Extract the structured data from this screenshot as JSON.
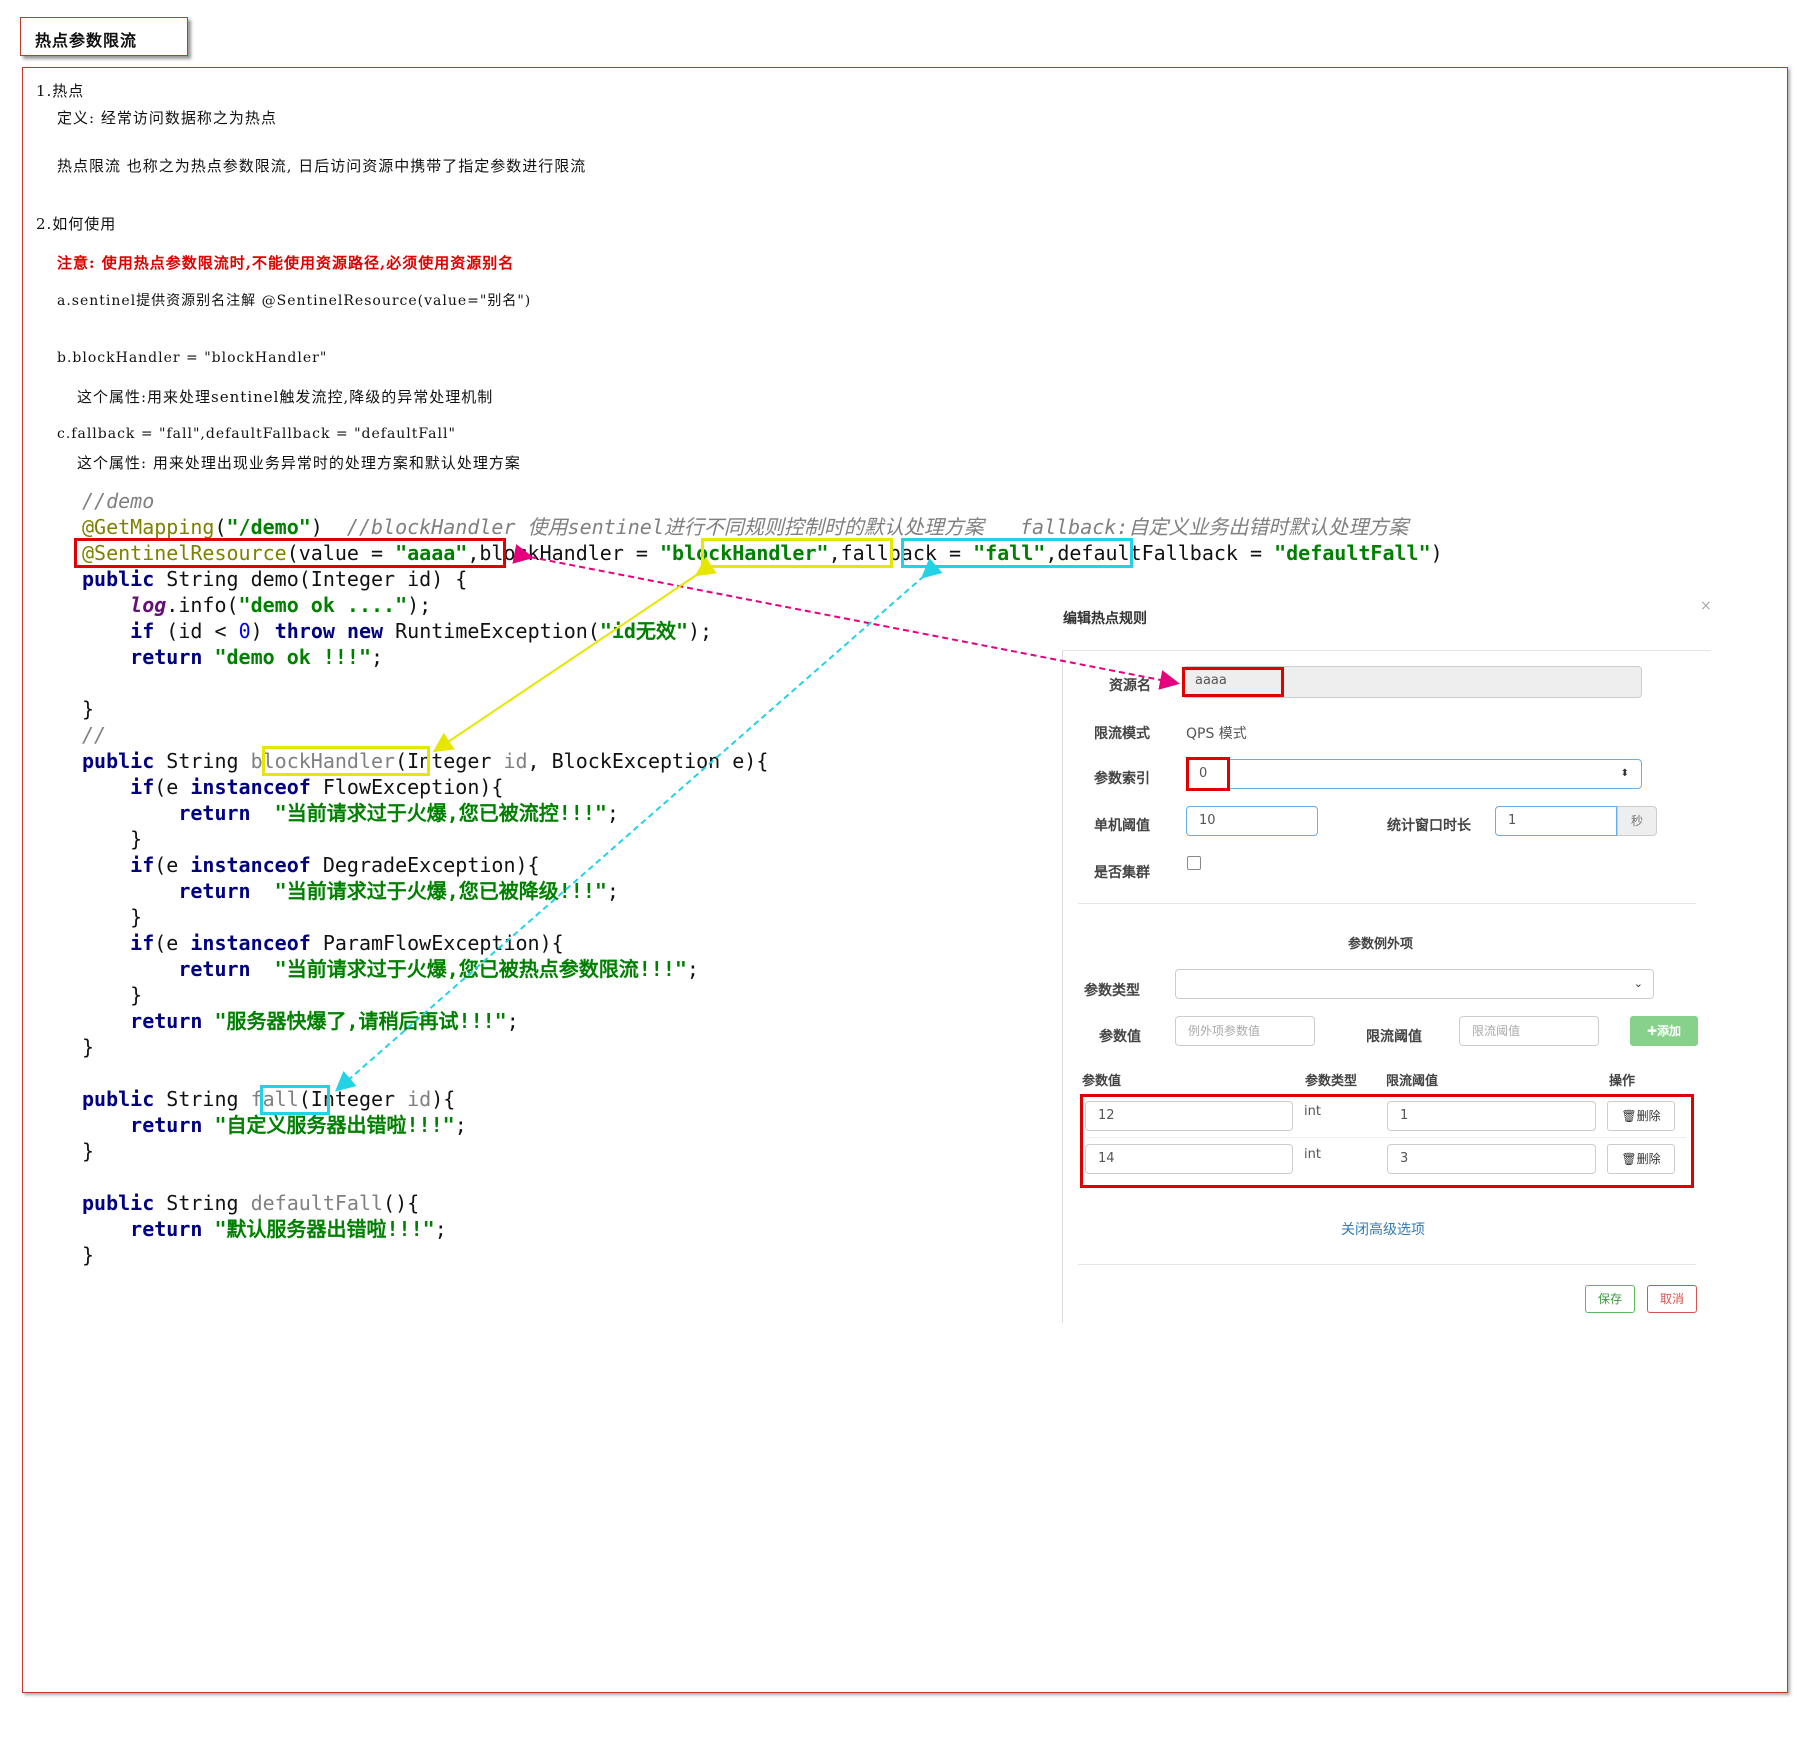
{
  "title": "热点参数限流",
  "notes": {
    "s1_heading": "1.热点",
    "s1_def": "定义: 经常访问数据称之为热点",
    "s1_desc": "热点限流 也称之为热点参数限流, 日后访问资源中携带了指定参数进行限流",
    "s2_heading": "2.如何使用",
    "warning": "注意: 使用热点参数限流时,不能使用资源路径,必须使用资源别名",
    "a": "a.sentinel提供资源别名注解  @SentinelResource(value=\"别名\")",
    "b": "b.blockHandler = \"blockHandler\"",
    "b_desc": "这个属性:用来处理sentinel触发流控,降级的异常处理机制",
    "c": "c.fallback = \"fall\",defaultFallback = \"defaultFall\"",
    "c_desc": "这个属性: 用来处理出现业务异常时的处理方案和默认处理方案"
  },
  "code": {
    "l01": "//demo",
    "l02_ann": "@GetMapping",
    "l02_path": "\"/demo\"",
    "l02_cmt": "//blockHandler 使用sentinel进行不同规则控制时的默认处理方案   fallback:自定义业务出错时默认处理方案",
    "l03_ann": "@SentinelResource",
    "l03_value": "\"aaaa\"",
    "l03_bh": "\"blockHandler\"",
    "l03_fb": "\"fall\"",
    "l03_dfb": "\"defaultFall\"",
    "l05_str": "\"demo ok ....\"",
    "l06_str": "\"id无效\"",
    "l07_str": "\"demo ok !!!\"",
    "l09": "//",
    "l10_name": "blockHandler",
    "l12_str": "\"当前请求过于火爆,您已被流控!!!\"",
    "l15_str": "\"当前请求过于火爆,您已被降级!!!\"",
    "l18_str": "\"当前请求过于火爆,您已被热点参数限流!!!\"",
    "l20_str": "\"服务器快爆了,请稍后再试!!!\"",
    "l22_name": "fall",
    "l23_str": "\"自定义服务器出错啦!!!\"",
    "l25_name": "defaultFall",
    "l26_str": "\"默认服务器出错啦!!!\""
  },
  "dialog": {
    "title": "编辑热点规则",
    "close": "×",
    "resource_label": "资源名",
    "resource_value": "aaaa",
    "mode_label": "限流模式",
    "mode_value": "QPS 模式",
    "index_label": "参数索引",
    "index_value": "0",
    "threshold_label": "单机阈值",
    "threshold_value": "10",
    "window_label": "统计窗口时长",
    "window_value": "1",
    "window_unit": "秒",
    "cluster_label": "是否集群",
    "exception_title": "参数例外项",
    "param_type_label": "参数类型",
    "param_value_label": "参数值",
    "param_value_placeholder": "例外项参数值",
    "limit_label": "限流阈值",
    "limit_placeholder": "限流阈值",
    "add_button": "✚添加",
    "table_headers": [
      "参数值",
      "参数类型",
      "限流阈值",
      "操作"
    ],
    "rows": [
      {
        "value": "12",
        "type": "int",
        "limit": "1",
        "action": "删除"
      },
      {
        "value": "14",
        "type": "int",
        "limit": "3",
        "action": "删除"
      }
    ],
    "close_advanced": "关闭高级选项",
    "save": "保存",
    "cancel": "取消"
  },
  "colors": {
    "red": "#e00000",
    "yellow": "#e6e600",
    "cyan": "#22d3e6",
    "pink": "#e6007e"
  }
}
